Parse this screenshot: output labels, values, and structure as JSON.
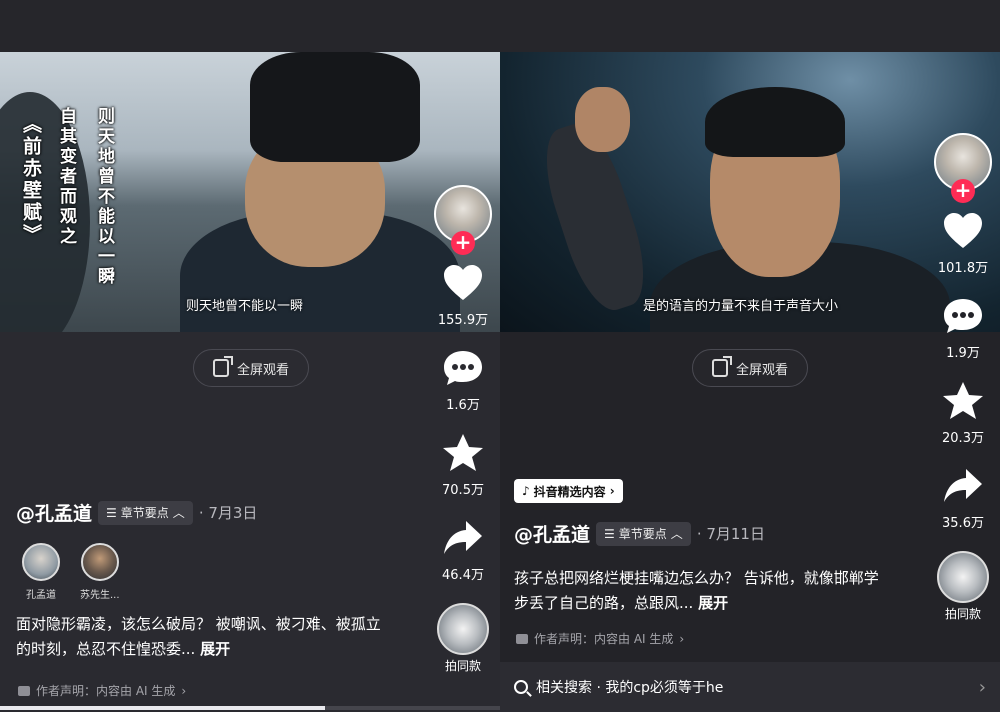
{
  "left": {
    "vertical_title": "《前赤壁赋》",
    "vertical_line1": "自其变者而观之",
    "vertical_line2": "则天地曾不能以一瞬",
    "subtitle": "则天地曾不能以一瞬",
    "fullscreen_label": "全屏观看",
    "likes": "155.9万",
    "comments": "1.6万",
    "favorites": "70.5万",
    "shares": "46.4万",
    "remix_label": "拍同款",
    "author": "@孔孟道",
    "chapter_label": "章节要点",
    "date": "· 7月3日",
    "collaborators": [
      "孔孟道",
      "苏先生..."
    ],
    "description": "面对隐形霸凌，该怎么破局？ 被嘲讽、被刁难、被孤立的时刻，总忍不住惶恐委...",
    "expand_label": "展开",
    "declaration": "作者声明：内容由 AI 生成",
    "progress": 0.65
  },
  "right": {
    "subtitle": "是的语言的力量不来自于声音大小",
    "fullscreen_label": "全屏观看",
    "likes": "101.8万",
    "comments": "1.9万",
    "favorites": "20.3万",
    "shares": "35.6万",
    "remix_label": "拍同款",
    "featured_tag": "抖音精选内容",
    "author": "@孔孟道",
    "chapter_label": "章节要点",
    "date": "· 7月11日",
    "description": "孩子总把网络烂梗挂嘴边怎么办？ 告诉他，就像邯郸学步丢了自己的路，总跟风...",
    "expand_label": "展开",
    "declaration": "作者声明：内容由 AI 生成",
    "related_search": "相关搜索 · 我的cp必须等于he"
  }
}
